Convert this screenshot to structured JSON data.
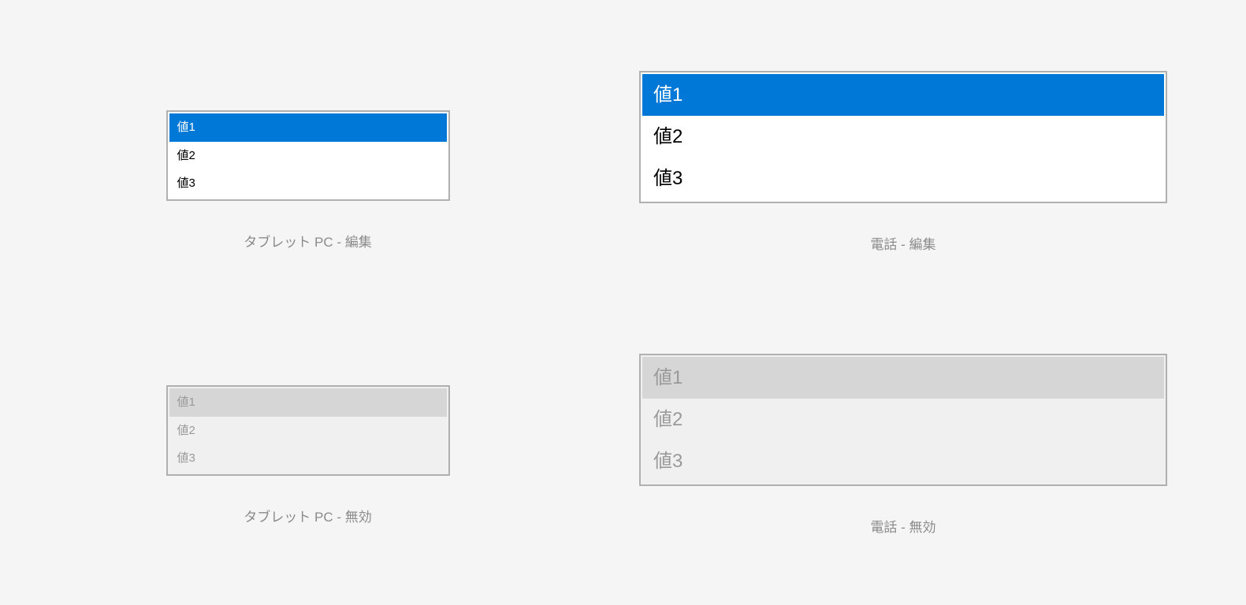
{
  "items": {
    "value1": "値1",
    "value2": "値2",
    "value3": "値3"
  },
  "captions": {
    "tablet_edit": "タブレット PC - 編集",
    "phone_edit": "電話 - 編集",
    "tablet_disabled": "タブレット PC - 無効",
    "phone_disabled": "電話 - 無効"
  }
}
